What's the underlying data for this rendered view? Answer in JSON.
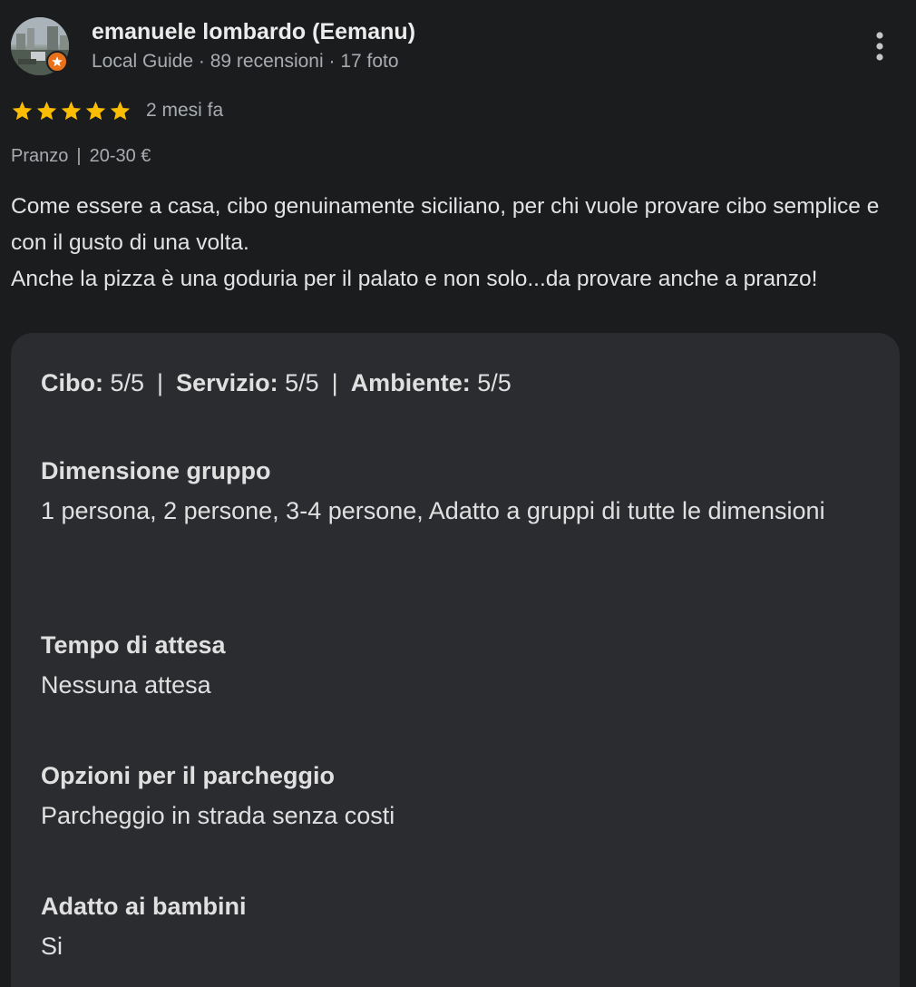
{
  "reviewer": {
    "name": "emanuele lombardo (Eemanu)",
    "meta": "Local Guide · 89 recensioni · 17 foto",
    "avatar_icon": "reviewer-avatar-photo",
    "badge_icon": "local-guide-star-icon",
    "badge_color": "#e8711a"
  },
  "more_button_icon": "more-vert-icon",
  "rating": {
    "stars": 5,
    "max_stars": 5,
    "star_color": "#fbbc04",
    "time_ago": "2 mesi fa"
  },
  "tags": {
    "meal": "Pranzo",
    "separator": "|",
    "price": "20-30 €"
  },
  "review_text": {
    "line1": "Come essere a casa, cibo genuinamente siciliano, per chi vuole provare cibo semplice e con il gusto di una volta.",
    "line2": "Anche la pizza è una goduria per il palato e non solo...da provare anche a pranzo!"
  },
  "sub_ratings": {
    "food_label": "Cibo:",
    "food_value": "5/5",
    "service_label": "Servizio:",
    "service_value": "5/5",
    "ambience_label": "Ambiente:",
    "ambience_value": "5/5",
    "separator": "|"
  },
  "details": [
    {
      "label": "Dimensione gruppo",
      "value": "1 persona, 2 persone, 3-4 persone, Adatto a gruppi di tutte le dimensioni"
    },
    {
      "label": "Tempo di attesa",
      "value": "Nessuna attesa"
    },
    {
      "label": "Opzioni per il parcheggio",
      "value": "Parcheggio in strada senza costi"
    },
    {
      "label": "Adatto ai bambini",
      "value": "Si"
    }
  ]
}
